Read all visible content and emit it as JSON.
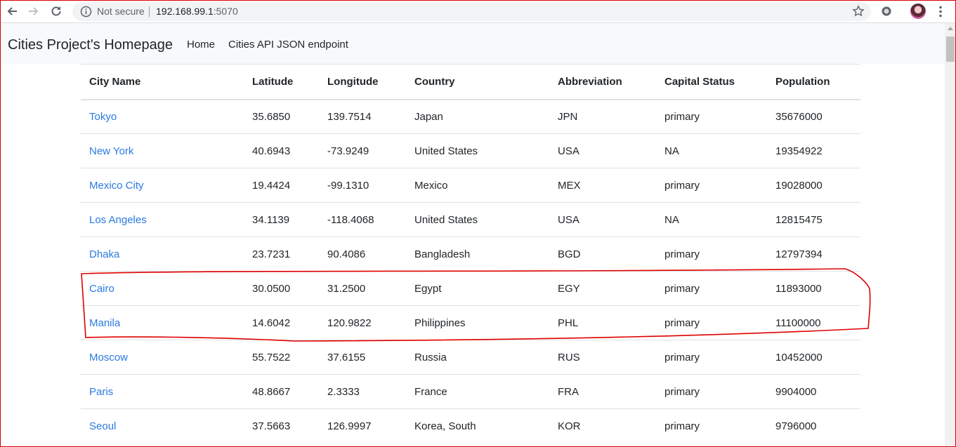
{
  "browser": {
    "security_label": "Not secure",
    "url_host": "192.168.99.1",
    "url_port": ":5070"
  },
  "navbar": {
    "brand": "Cities Project's Homepage",
    "links": [
      "Home",
      "Cities API JSON endpoint"
    ]
  },
  "table": {
    "headers": [
      "City Name",
      "Latitude",
      "Longitude",
      "Country",
      "Abbreviation",
      "Capital Status",
      "Population"
    ],
    "rows": [
      [
        "Tokyo",
        "35.6850",
        "139.7514",
        "Japan",
        "JPN",
        "primary",
        "35676000"
      ],
      [
        "New York",
        "40.6943",
        "-73.9249",
        "United States",
        "USA",
        "NA",
        "19354922"
      ],
      [
        "Mexico City",
        "19.4424",
        "-99.1310",
        "Mexico",
        "MEX",
        "primary",
        "19028000"
      ],
      [
        "Los Angeles",
        "34.1139",
        "-118.4068",
        "United States",
        "USA",
        "NA",
        "12815475"
      ],
      [
        "Dhaka",
        "23.7231",
        "90.4086",
        "Bangladesh",
        "BGD",
        "primary",
        "12797394"
      ],
      [
        "Cairo",
        "30.0500",
        "31.2500",
        "Egypt",
        "EGY",
        "primary",
        "11893000"
      ],
      [
        "Manila",
        "14.6042",
        "120.9822",
        "Philippines",
        "PHL",
        "primary",
        "11100000"
      ],
      [
        "Moscow",
        "55.7522",
        "37.6155",
        "Russia",
        "RUS",
        "primary",
        "10452000"
      ],
      [
        "Paris",
        "48.8667",
        "2.3333",
        "France",
        "FRA",
        "primary",
        "9904000"
      ],
      [
        "Seoul",
        "37.5663",
        "126.9997",
        "Korea, South",
        "KOR",
        "primary",
        "9796000"
      ]
    ]
  },
  "colors": {
    "link": "#2a7ae2",
    "annotation": "#e00000",
    "navbar_bg": "#f8f9fa"
  }
}
